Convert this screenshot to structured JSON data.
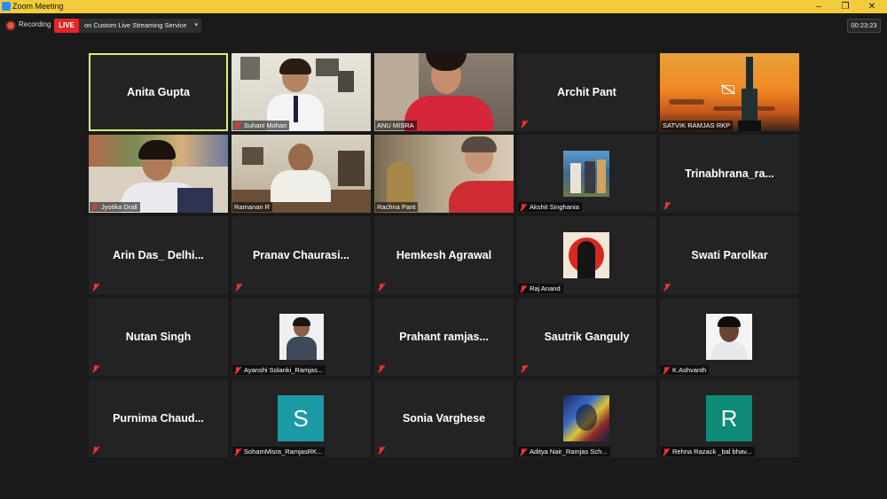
{
  "window": {
    "title": "Zoom Meeting",
    "minimize": "–",
    "maximize": "❐",
    "close": "✕"
  },
  "toolbar": {
    "recording_label": "Recording",
    "live_label": "LIVE",
    "stream_label": "on Custom Live Streaming Service",
    "stream_chevron": "▾",
    "timer": "00:23:23"
  },
  "participants": [
    {
      "name": "Anita Gupta",
      "display": "center",
      "active": true
    },
    {
      "name": "Suhani Mohan",
      "display": "video"
    },
    {
      "name": "ANU MISRA",
      "display": "video"
    },
    {
      "name": "Archit Pant",
      "display": "center"
    },
    {
      "name": "SATVIK RAMJAS RKP",
      "display": "video"
    },
    {
      "name": "Jyotika Drall",
      "display": "video"
    },
    {
      "name": "Ramanan R",
      "display": "video"
    },
    {
      "name": "Rachna Pant",
      "display": "video"
    },
    {
      "name": "Akshit Singhania",
      "display": "picture"
    },
    {
      "name": "Trinabhrana_ra...",
      "display": "center"
    },
    {
      "name": "Arin Das_ Delhi...",
      "display": "center"
    },
    {
      "name": "Pranav  Chaurasi...",
      "display": "center"
    },
    {
      "name": "Hemkesh Agrawal",
      "display": "center"
    },
    {
      "name": "Raj Anand",
      "display": "picture"
    },
    {
      "name": "Swati Parolkar",
      "display": "center"
    },
    {
      "name": "Nutan Singh",
      "display": "center"
    },
    {
      "name": "Ayanshi Solanki_Ramjas...",
      "display": "picture"
    },
    {
      "name": "Prahant  ramjas...",
      "display": "center"
    },
    {
      "name": "Sautrik Ganguly",
      "display": "center"
    },
    {
      "name": "K.Ashvanth",
      "display": "picture"
    },
    {
      "name": "Purnima  Chaud...",
      "display": "center"
    },
    {
      "name": "SohamMisra_RamjasRK...",
      "display": "avatar",
      "letter": "S",
      "color": "#1b9aa6"
    },
    {
      "name": "Sonia Varghese",
      "display": "center"
    },
    {
      "name": "Aditya Nair_Ramjas Sch...",
      "display": "picture"
    },
    {
      "name": "Rehna Razack _bal bhav...",
      "display": "avatar",
      "letter": "R",
      "color": "#0e8a78"
    }
  ]
}
